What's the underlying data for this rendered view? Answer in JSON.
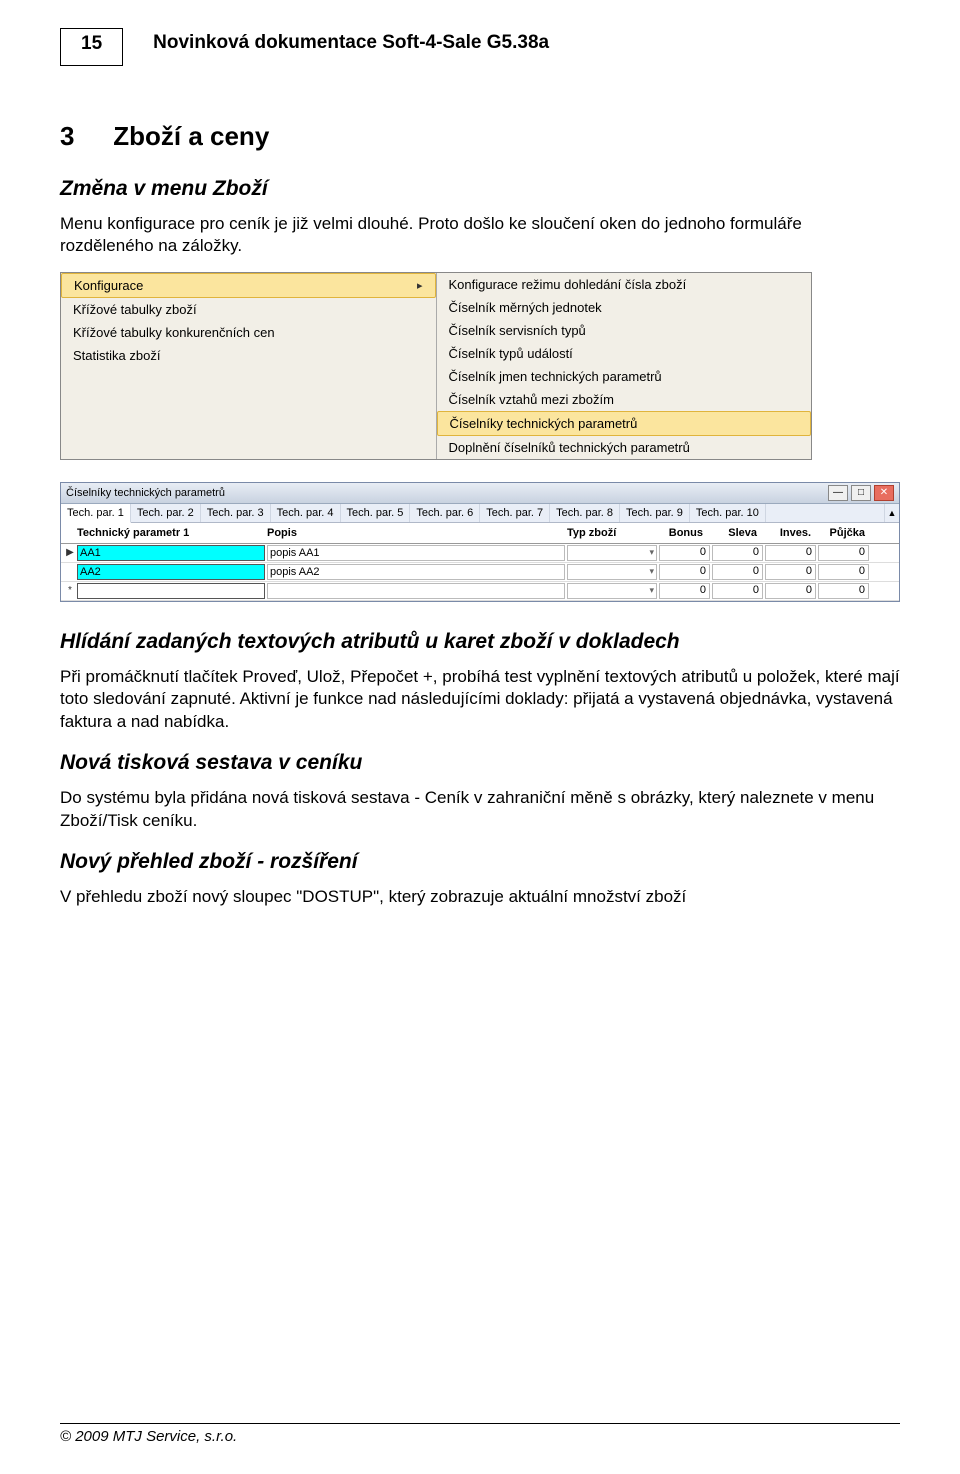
{
  "page_number": "15",
  "header_title": "Novinková dokumentace Soft-4-Sale G5.38a",
  "section": {
    "number": "3",
    "title": "Zboží a ceny"
  },
  "sub1": {
    "title": "Změna v menu Zboží",
    "body": "Menu konfigurace pro ceník je již velmi dlouhé. Proto došlo ke sloučení oken do jednoho formuláře rozděleného na záložky."
  },
  "menu_left": {
    "items": [
      {
        "label": "Konfigurace",
        "highlight": true,
        "arrow": true
      },
      {
        "label": "Křížové tabulky zboží"
      },
      {
        "label": "Křížové tabulky konkurenčních cen"
      },
      {
        "label": "Statistika zboží"
      }
    ]
  },
  "menu_right": {
    "items": [
      {
        "label": "Konfigurace režimu dohledání čísla zboží"
      },
      {
        "label": "Číselník měrných jednotek"
      },
      {
        "label": "Číselník servisních typů"
      },
      {
        "label": "Číselník typů událostí"
      },
      {
        "label": "Číselník jmen technických parametrů"
      },
      {
        "label": "Číselník vztahů mezi zbožím"
      },
      {
        "label": "Číselníky technických parametrů",
        "highlight": true
      },
      {
        "label": "Doplnění číselníků technických parametrů"
      }
    ]
  },
  "params_window": {
    "title": "Číselníky technických parametrů",
    "tabs": [
      "Tech. par. 1",
      "Tech. par. 2",
      "Tech. par. 3",
      "Tech. par. 4",
      "Tech. par. 5",
      "Tech. par. 6",
      "Tech. par. 7",
      "Tech. par. 8",
      "Tech. par. 9",
      "Tech. par. 10"
    ],
    "columns": {
      "name": "Technický parametr 1",
      "popis": "Popis",
      "typ": "Typ zboží",
      "bonus": "Bonus",
      "sleva": "Sleva",
      "inves": "Inves.",
      "pujcka": "Půjčka"
    },
    "rows": [
      {
        "selector": "▶",
        "name": "AA1",
        "popis": "popis AA1",
        "bonus": "0",
        "sleva": "0",
        "inves": "0",
        "pujcka": "0"
      },
      {
        "selector": "",
        "name": "AA2",
        "popis": "popis AA2",
        "bonus": "0",
        "sleva": "0",
        "inves": "0",
        "pujcka": "0"
      },
      {
        "selector": "*",
        "name": "",
        "popis": "",
        "bonus": "0",
        "sleva": "0",
        "inves": "0",
        "pujcka": "0",
        "new": true
      }
    ]
  },
  "sub2": {
    "title": "Hlídání zadaných textových atributů u karet zboží v dokladech",
    "body": "Při promáčknutí tlačítek Proveď, Ulož, Přepočet +, probíhá test vyplnění textových atributů u položek, které mají toto sledování zapnuté. Aktivní je funkce nad následujícími doklady: přijatá a vystavená objednávka, vystavená faktura a nad nabídka."
  },
  "sub3": {
    "title": "Nová tisková sestava v ceníku",
    "body": "Do systému byla přidána nová tisková sestava - Ceník v zahraniční měně s obrázky, který naleznete v menu Zboží/Tisk ceníku."
  },
  "sub4": {
    "title": "Nový přehled zboží - rozšíření",
    "body": "V přehledu zboží nový sloupec \"DOSTUP\", který zobrazuje aktuální množství zboží"
  },
  "footer": "© 2009 MTJ Service, s.r.o."
}
